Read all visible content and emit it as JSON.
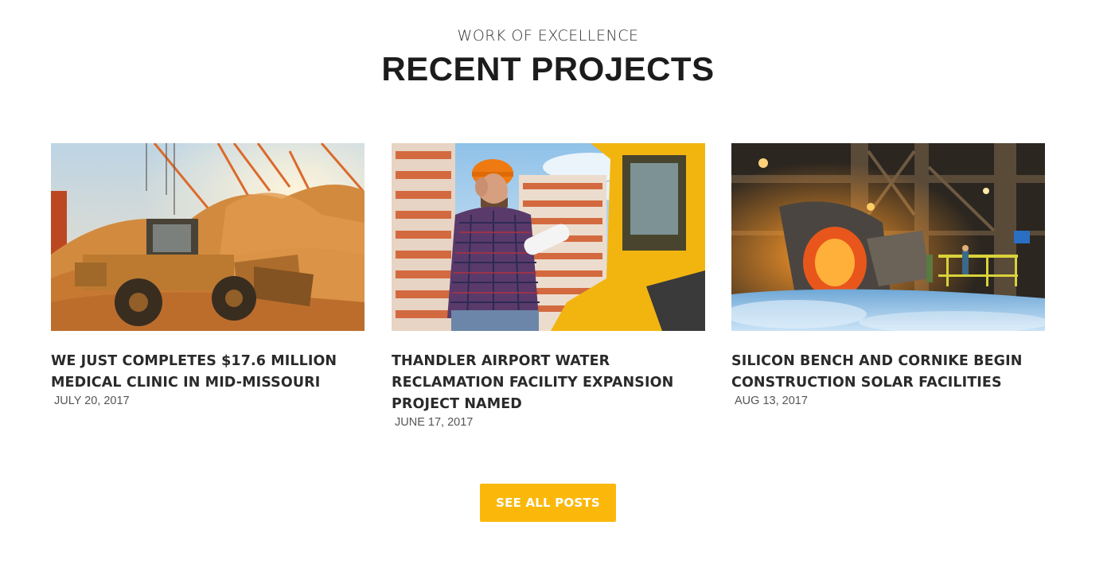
{
  "section": {
    "eyebrow": "WORK OF EXCELLENCE",
    "title": "RECENT PROJECTS"
  },
  "projects": [
    {
      "title": "WE JUST COMPLETES $17.6 MILLION MEDICAL CLINIC IN MID-MISSOURI",
      "date": "JULY 20, 2017",
      "image": "wheel-loader-photo"
    },
    {
      "title": "THANDLER AIRPORT WATER RECLAMATION FACILITY EXPANSION PROJECT NAMED",
      "date": "JUNE 17, 2017",
      "image": "construction-worker-photo"
    },
    {
      "title": "SILICON BENCH AND CORNIKE BEGIN CONSTRUCTION SOLAR FACILITIES",
      "date": "AUG 13, 2017",
      "image": "steel-foundry-photo"
    }
  ],
  "cta": {
    "label": "SEE ALL POSTS"
  },
  "colors": {
    "accent": "#fbb80a",
    "heading": "#1c1c1c",
    "text": "#2a2a2a",
    "muted": "#555555"
  }
}
